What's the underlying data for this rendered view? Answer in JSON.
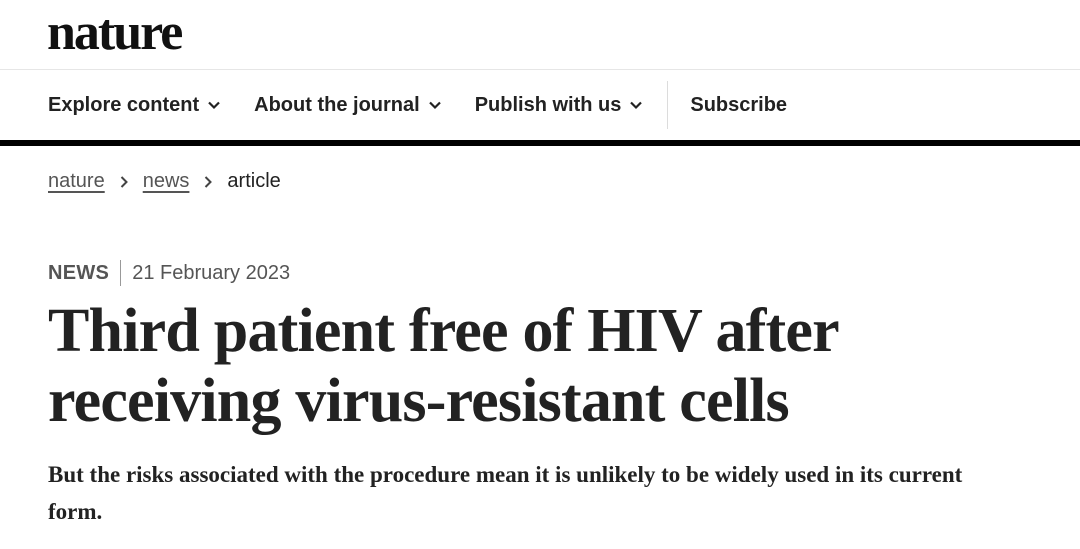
{
  "header": {
    "logo": "nature"
  },
  "nav": {
    "items": [
      {
        "label": "Explore content",
        "icon": "chevron-down-icon"
      },
      {
        "label": "About the journal",
        "icon": "chevron-down-icon"
      },
      {
        "label": "Publish with us",
        "icon": "chevron-down-icon"
      }
    ],
    "subscribe": "Subscribe"
  },
  "breadcrumb": {
    "items": [
      "nature",
      "news"
    ],
    "current": "article",
    "separator_icon": "chevron-right-icon"
  },
  "article": {
    "type": "NEWS",
    "date": "21 February 2023",
    "title": "Third patient free of HIV after receiving virus-resistant cells",
    "standfirst": "But the risks associated with the procedure mean it is unlikely to be widely used in its current form."
  }
}
